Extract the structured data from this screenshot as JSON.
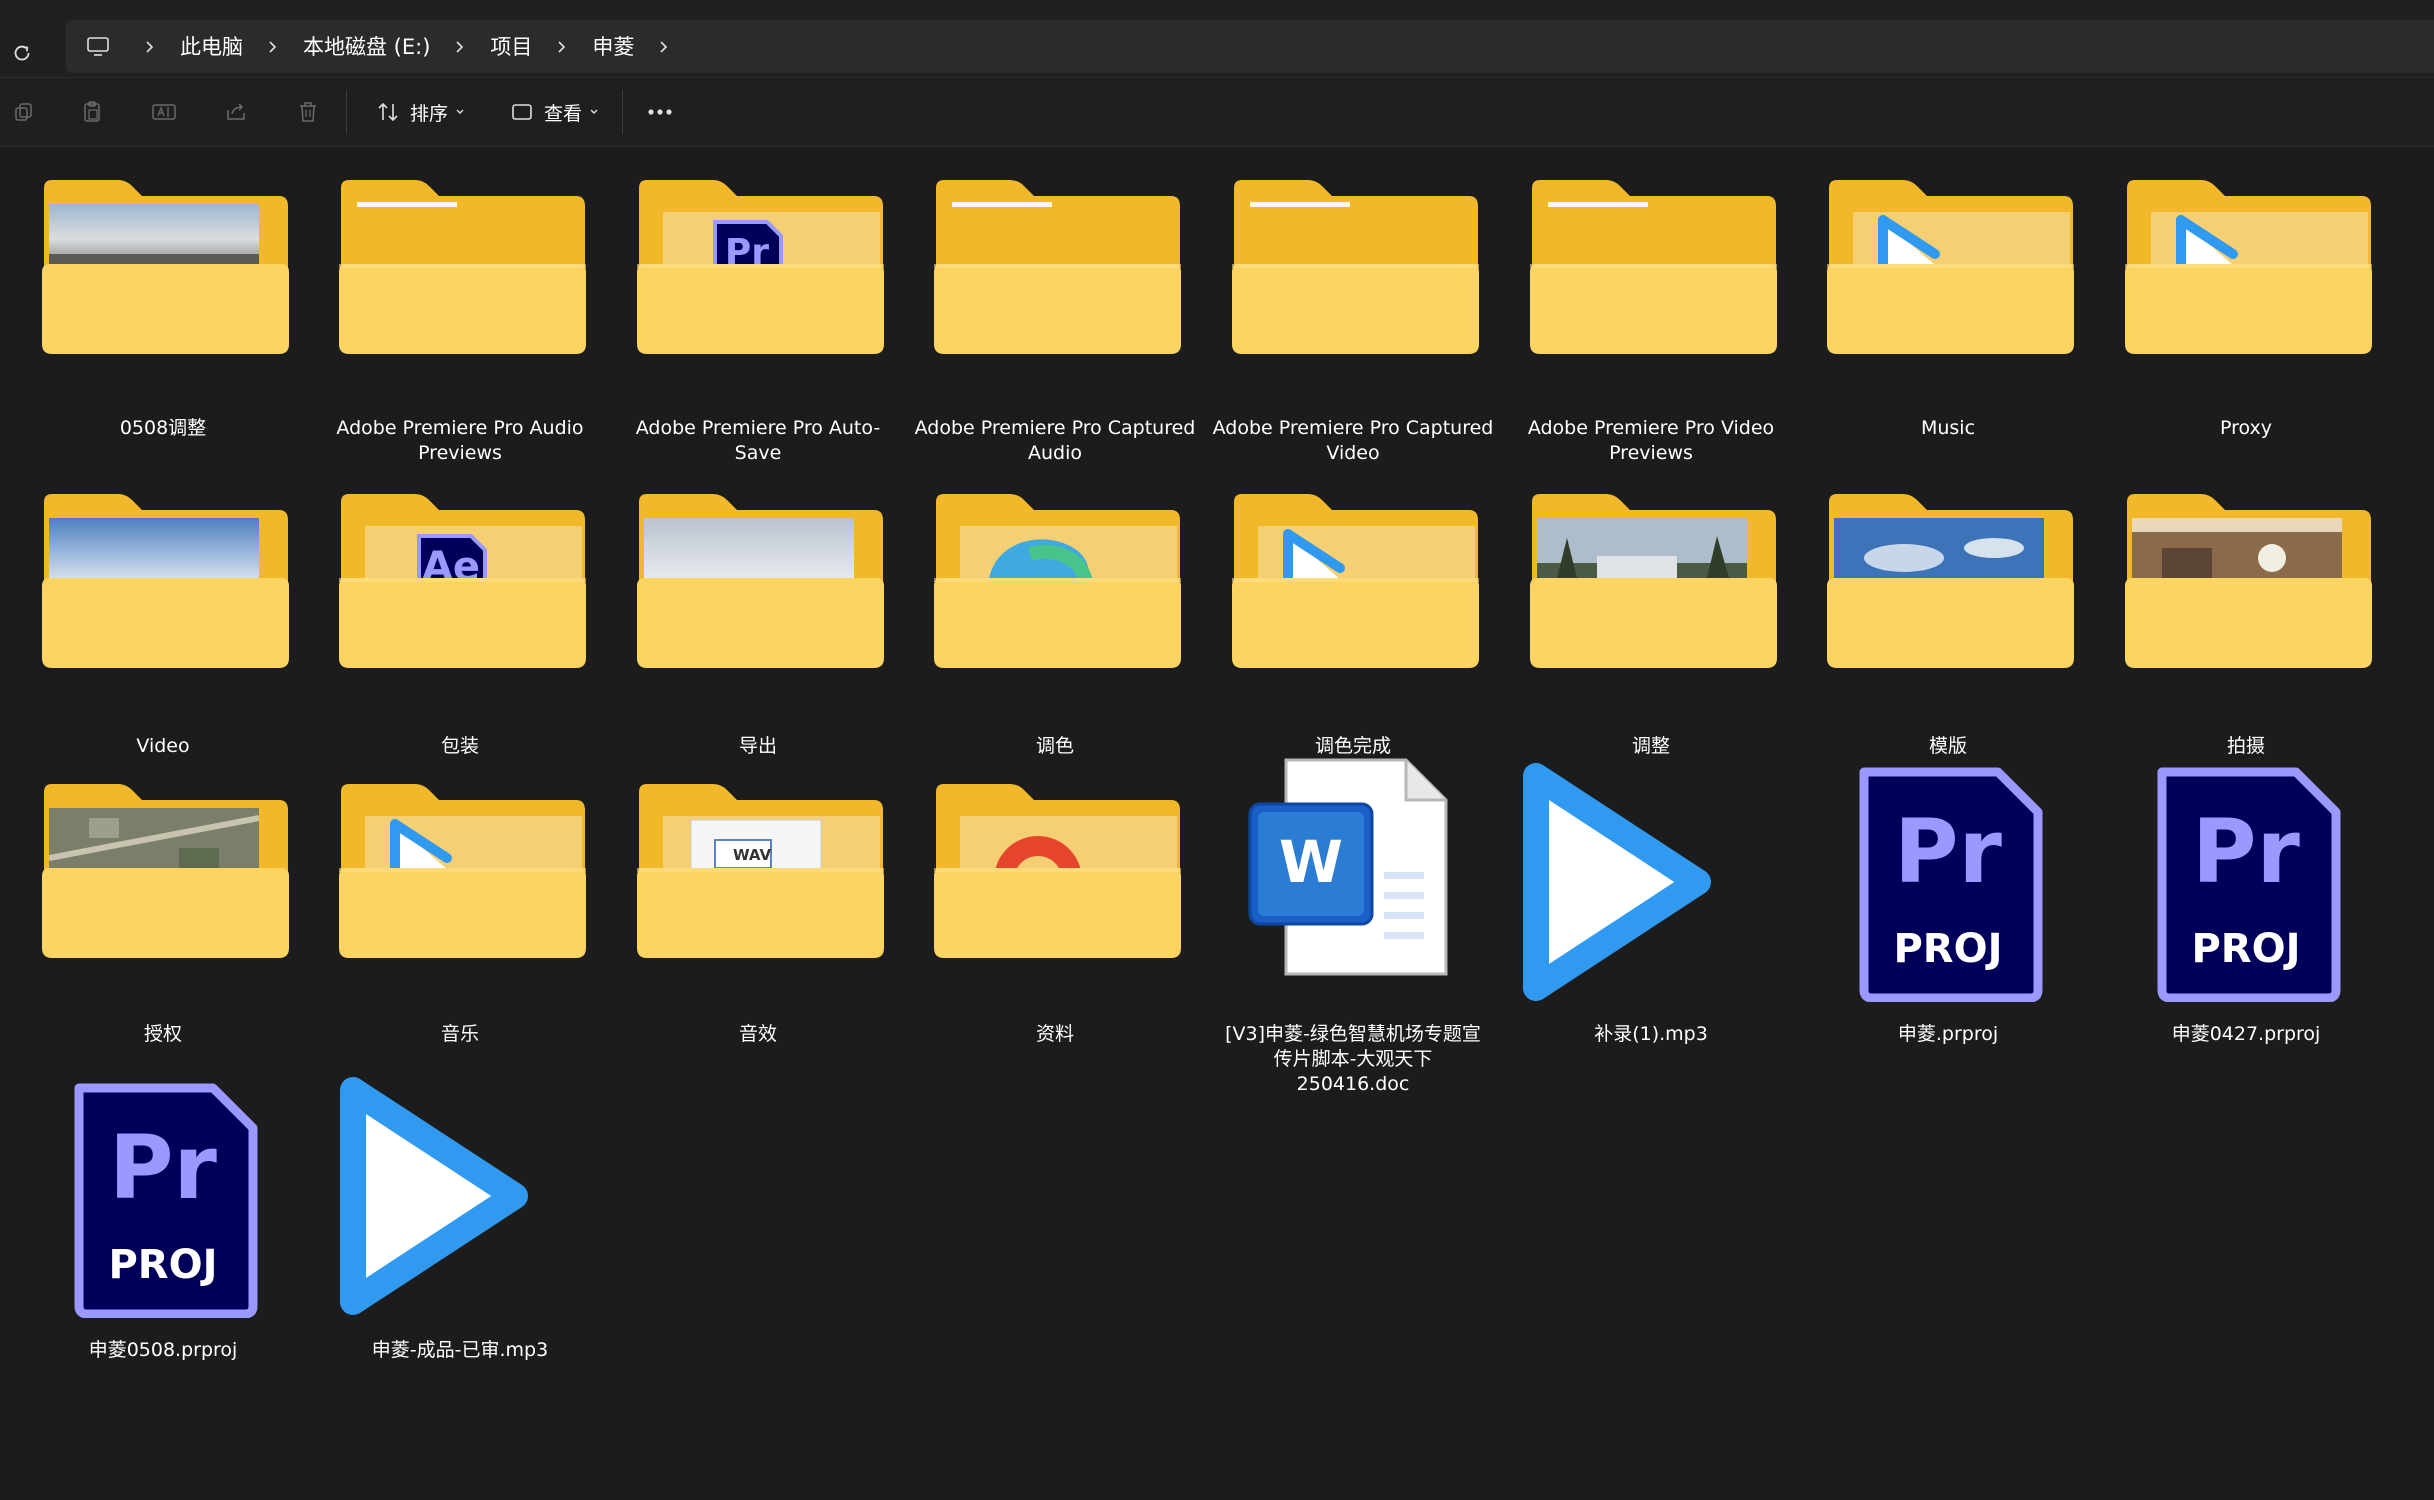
{
  "address": {
    "refresh_icon": "refresh-icon",
    "computer_icon": "computer-icon",
    "breadcrumbs": [
      "此电脑",
      "本地磁盘 (E:)",
      "项目",
      "申菱"
    ]
  },
  "toolbar": {
    "sort_label": "排序",
    "view_label": "查看",
    "icons": [
      "copy-icon",
      "paste-icon",
      "rename-icon",
      "share-icon",
      "delete-icon",
      "more-icon"
    ]
  },
  "items": [
    {
      "name": "0508调整",
      "type": "folder",
      "preview": "landscape-photo"
    },
    {
      "name": "Adobe Premiere Pro Audio Previews",
      "type": "folder",
      "preview": "empty"
    },
    {
      "name": "Adobe Premiere Pro Auto-Save",
      "type": "folder",
      "preview": "premiere-pr"
    },
    {
      "name": "Adobe Premiere Pro Captured Audio",
      "type": "folder",
      "preview": "empty"
    },
    {
      "name": "Adobe Premiere Pro Captured Video",
      "type": "folder",
      "preview": "empty"
    },
    {
      "name": "Adobe Premiere Pro Video Previews",
      "type": "folder",
      "preview": "empty"
    },
    {
      "name": "Music",
      "type": "folder",
      "preview": "play"
    },
    {
      "name": "Proxy",
      "type": "folder",
      "preview": "play"
    },
    {
      "name": "Video",
      "type": "folder",
      "preview": "sky-photo"
    },
    {
      "name": "包装",
      "type": "folder",
      "preview": "after-effects-ae"
    },
    {
      "name": "导出",
      "type": "folder",
      "preview": "cloud-photo"
    },
    {
      "name": "调色",
      "type": "folder",
      "preview": "edge-logo"
    },
    {
      "name": "调色完成",
      "type": "folder",
      "preview": "play"
    },
    {
      "name": "调整",
      "type": "folder",
      "preview": "palm-photo"
    },
    {
      "name": "模版",
      "type": "folder",
      "preview": "blue-sky-photo"
    },
    {
      "name": "拍摄",
      "type": "folder",
      "preview": "interior-photo"
    },
    {
      "name": "授权",
      "type": "folder",
      "preview": "aerial-photo"
    },
    {
      "name": "音乐",
      "type": "folder",
      "preview": "play"
    },
    {
      "name": "音效",
      "type": "folder",
      "preview": "wav"
    },
    {
      "name": "资料",
      "type": "folder",
      "preview": "office-logo"
    },
    {
      "name": "[V3]申菱-绿色智慧机场专题宣传片脚本-大观天下 250416.doc",
      "type": "word"
    },
    {
      "name": "补录(1).mp3",
      "type": "mp3"
    },
    {
      "name": "申菱.prproj",
      "type": "prproj"
    },
    {
      "name": "申菱0427.prproj",
      "type": "prproj"
    },
    {
      "name": "申菱0508.prproj",
      "type": "prproj"
    },
    {
      "name": "申菱-成品-已审.mp3",
      "type": "mp3"
    }
  ],
  "icon_text": {
    "pr": "Pr",
    "ae": "Ae",
    "proj": "PROJ",
    "word": "W",
    "wav": "WAV"
  },
  "colors": {
    "background": "#1c1c1c",
    "folder": "#fcd462",
    "folder_back": "#f1b92a",
    "play_blue": "#2f9af0",
    "premiere_bg": "#00005b",
    "premiere_accent": "#9999ff"
  }
}
